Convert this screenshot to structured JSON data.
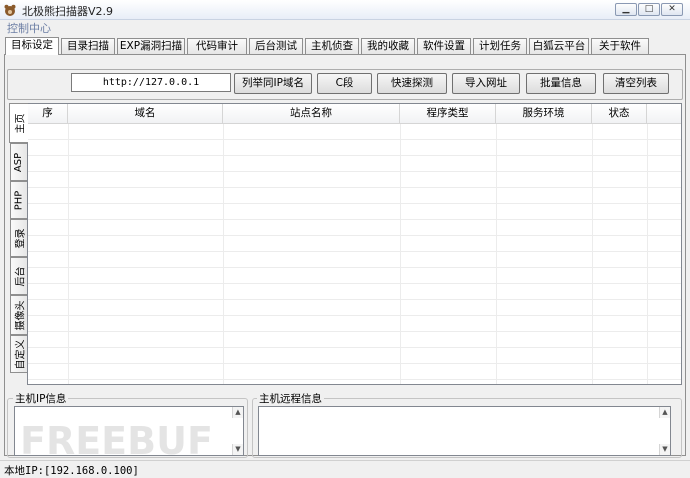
{
  "window": {
    "title": "北极熊扫描器V2.9",
    "min_glyph": "▁",
    "max_glyph": "□",
    "close_glyph": "✕",
    "icon": "bear-icon"
  },
  "menu": {
    "items": [
      "控制中心"
    ]
  },
  "tabs": [
    {
      "label": "目标设定",
      "active": true
    },
    {
      "label": "目录扫描"
    },
    {
      "label": "EXP漏洞扫描"
    },
    {
      "label": "代码审计"
    },
    {
      "label": "后台测试"
    },
    {
      "label": "主机侦查"
    },
    {
      "label": "我的收藏"
    },
    {
      "label": "软件设置"
    },
    {
      "label": "计划任务"
    },
    {
      "label": "白狐云平台"
    },
    {
      "label": "关于软件"
    }
  ],
  "toolbar": {
    "url_value": "http://127.0.0.1",
    "buttons": [
      "列举同IP域名",
      "C段",
      "快速探测",
      "导入网址",
      "批量信息",
      "清空列表"
    ]
  },
  "side_tabs": [
    {
      "label": "主页",
      "active": true
    },
    {
      "label": "ASP"
    },
    {
      "label": "PHP"
    },
    {
      "label": "登录"
    },
    {
      "label": "后台"
    },
    {
      "label": "摄像头"
    },
    {
      "label": "自定义"
    }
  ],
  "results_table": {
    "columns": [
      "序",
      "域名",
      "站点名称",
      "程序类型",
      "服务环境",
      "状态"
    ],
    "rows": []
  },
  "host_ip_panel": {
    "label": "主机IP信息",
    "up_glyph": "▲",
    "down_glyph": "▼"
  },
  "host_remote_panel": {
    "label": "主机远程信息",
    "up_glyph": "▲",
    "down_glyph": "▼"
  },
  "status_bar": {
    "text": "本地IP:[192.168.0.100]"
  },
  "watermark": {
    "text": "FREEBUF"
  },
  "colors": {
    "menu_text": "#6d7fa5",
    "title_bar": "#e8eef7"
  }
}
